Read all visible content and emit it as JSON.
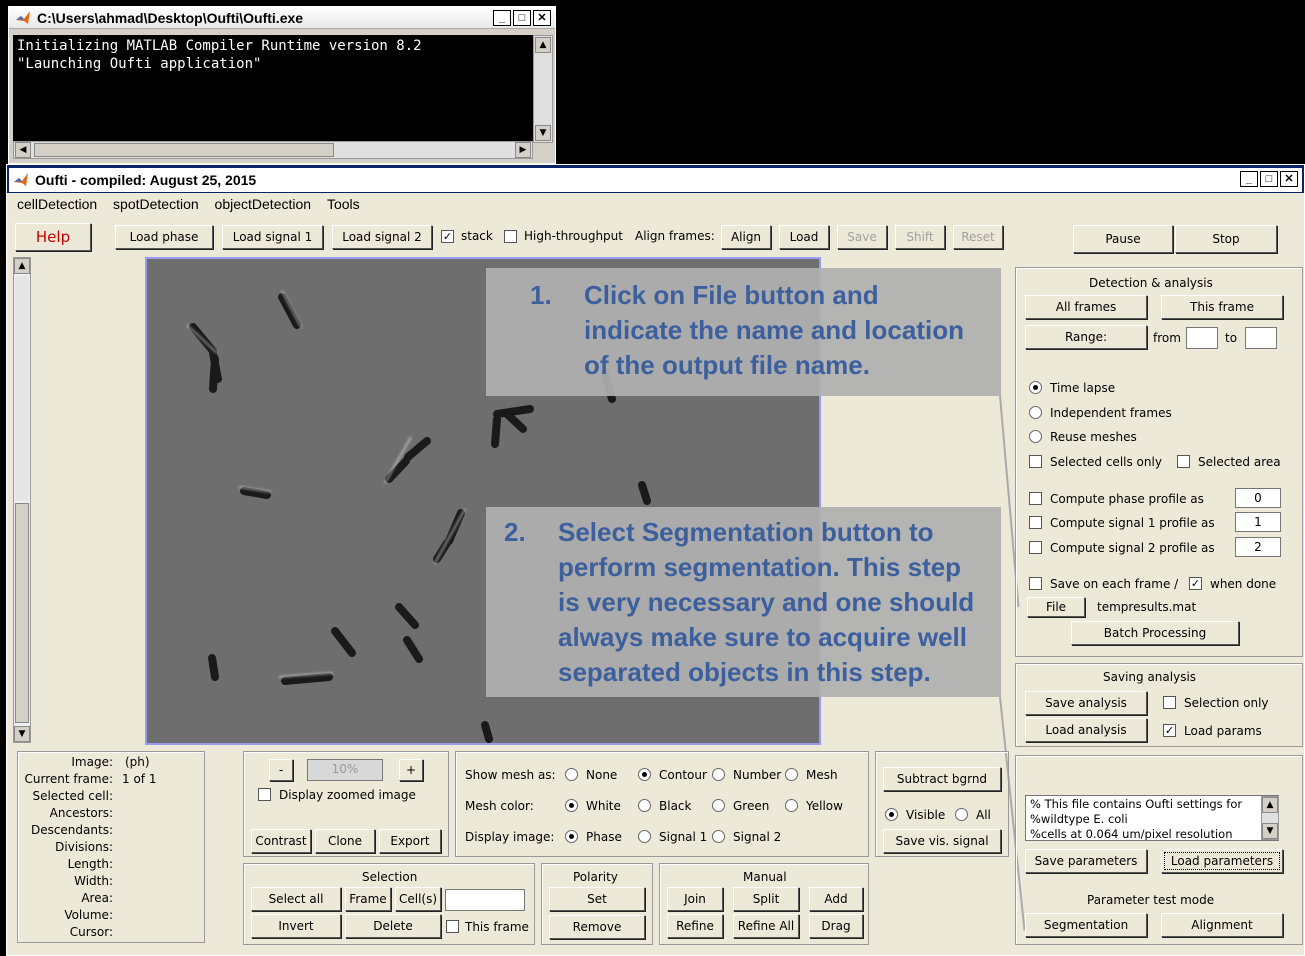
{
  "console": {
    "title": "C:\\Users\\ahmad\\Desktop\\Oufti\\Oufti.exe",
    "line1": "Initializing MATLAB Compiler Runtime version 8.2",
    "line2": "\"Launching Oufti application\""
  },
  "window": {
    "title": "Oufti - compiled:  August 25, 2015",
    "min": "_",
    "max": "□",
    "close": "X"
  },
  "menu": [
    "cellDetection",
    "spotDetection",
    "objectDetection",
    "Tools"
  ],
  "toolbar": {
    "help": "Help",
    "load_phase": "Load phase",
    "load_signal1": "Load signal 1",
    "load_signal2": "Load signal 2",
    "stack": "stack",
    "high_throughput": "High-throughput",
    "align_frames": "Align frames:",
    "align": "Align",
    "load": "Load",
    "save": "Save",
    "shift": "Shift",
    "reset": "Reset",
    "pause": "Pause",
    "stop": "Stop"
  },
  "callouts": {
    "c1_num": "1.",
    "c1_text": "Click on File button and indicate the name and location of the output file name.",
    "c2_num": "2.",
    "c2_text": "Select Segmentation button to perform segmentation.  This step is very necessary and one should always make sure to acquire well separated objects in this step."
  },
  "detection": {
    "title": "Detection & analysis",
    "all_frames": "All frames",
    "this_frame": "This frame",
    "range": "Range:",
    "from": "from",
    "to": "to",
    "time_lapse": "Time lapse",
    "independent": "Independent frames",
    "reuse": "Reuse meshes",
    "selected_cells": "Selected cells only",
    "selected_area": "Selected area",
    "phase_profile": "Compute phase profile as",
    "phase_val": "0",
    "sig1_profile": "Compute signal 1 profile as",
    "sig1_val": "1",
    "sig2_profile": "Compute signal 2 profile as",
    "sig2_val": "2",
    "save_each": "Save on each frame /",
    "when_done": "when done",
    "file": "File",
    "filename": "tempresults.mat",
    "batch": "Batch Processing"
  },
  "saving": {
    "title": "Saving analysis",
    "save_analysis": "Save analysis",
    "selection_only": "Selection only",
    "load_analysis": "Load analysis",
    "load_params": "Load params"
  },
  "params": {
    "lines": [
      "% This file contains Oufti settings for",
      "%wildtype E. coli",
      "%cells at 0.064 um/pixel resolution"
    ],
    "save_parameters": "Save parameters",
    "load_parameters": "Load parameters",
    "test_mode": "Parameter test mode",
    "segmentation": "Segmentation",
    "alignment": "Alignment"
  },
  "info": {
    "labels": [
      "Image:",
      "Current frame:",
      "Selected cell:",
      "Ancestors:",
      "Descendants:",
      "Divisions:",
      "Length:",
      "Width:",
      "Area:",
      "Volume:",
      "Cursor:"
    ],
    "image_val": "(ph)",
    "frame_val": "1 of 1"
  },
  "zoom": {
    "minus": "-",
    "value": "10%",
    "plus": "+",
    "display_zoomed": "Display zoomed image",
    "contrast": "Contrast",
    "clone": "Clone",
    "export": "Export"
  },
  "mesh": {
    "show_label": "Show mesh as:",
    "none": "None",
    "contour": "Contour",
    "number": "Number",
    "mesh": "Mesh",
    "color_label": "Mesh color:",
    "white": "White",
    "black": "Black",
    "green": "Green",
    "yellow": "Yellow",
    "display_label": "Display image:",
    "phase": "Phase",
    "signal1": "Signal 1",
    "signal2": "Signal 2"
  },
  "bgrnd": {
    "subtract": "Subtract bgrnd",
    "visible": "Visible",
    "all": "All",
    "save_vis": "Save vis. signal"
  },
  "selection": {
    "title": "Selection",
    "select_all": "Select all",
    "frame": "Frame",
    "cells": "Cell(s)",
    "invert": "Invert",
    "delete": "Delete",
    "this_frame": "This frame"
  },
  "polarity": {
    "title": "Polarity",
    "set": "Set",
    "remove": "Remove"
  },
  "manual": {
    "title": "Manual",
    "join": "Join",
    "split": "Split",
    "add": "Add",
    "refine": "Refine",
    "refine_all": "Refine All",
    "drag": "Drag"
  },
  "colors": {
    "callout_text": "#3c5f9e",
    "help_text": "#cc0000"
  }
}
